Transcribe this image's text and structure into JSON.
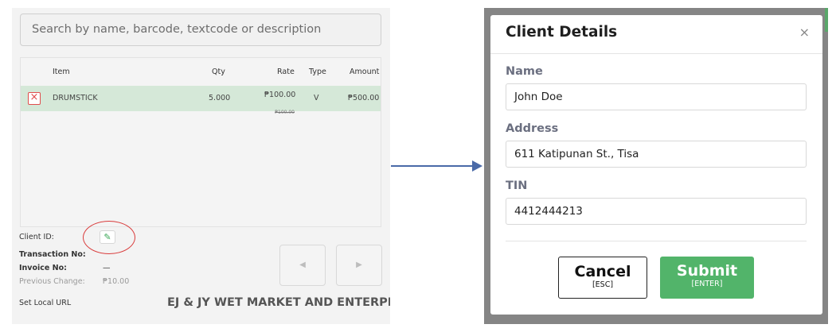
{
  "left": {
    "search_placeholder": "Search by name, barcode, textcode or description",
    "table": {
      "headers": {
        "item": "Item",
        "qty": "Qty",
        "rate": "Rate",
        "type": "Type",
        "amount": "Amount"
      },
      "rows": [
        {
          "item": "DRUMSTICK",
          "qty": "5.000",
          "rate": "₱100.00",
          "rate_original": "₱100.00",
          "type": "V",
          "amount": "₱500.00"
        }
      ]
    },
    "info": {
      "client_id_label": "Client ID:",
      "transaction_label": "Transaction No:",
      "invoice_label": "Invoice No:",
      "invoice_value": "—",
      "prev_change_label": "Previous Change:",
      "prev_change_value": "₱10.00",
      "set_local_url": "Set Local URL",
      "company_name": "EJ & JY WET MARKET AND ENTERPRISE"
    },
    "icons": {
      "delete": "×",
      "edit": "✎",
      "prev": "◀",
      "next": "▶"
    }
  },
  "modal": {
    "title": "Client Details",
    "close": "×",
    "fields": [
      {
        "label": "Name",
        "value": "John Doe"
      },
      {
        "label": "Address",
        "value": "611 Katipunan St., Tisa"
      },
      {
        "label": "TIN",
        "value": "4412444213"
      }
    ],
    "cancel": {
      "label": "Cancel",
      "shortcut": "[ESC]"
    },
    "submit": {
      "label": "Submit",
      "shortcut": "[ENTER]"
    }
  },
  "colors": {
    "accent_green": "#52b46a",
    "row_highlight": "#d5e8d8",
    "annotation_red": "#d93b3b",
    "arrow_blue": "#4a6aa8",
    "overlay_gray": "#858585"
  }
}
